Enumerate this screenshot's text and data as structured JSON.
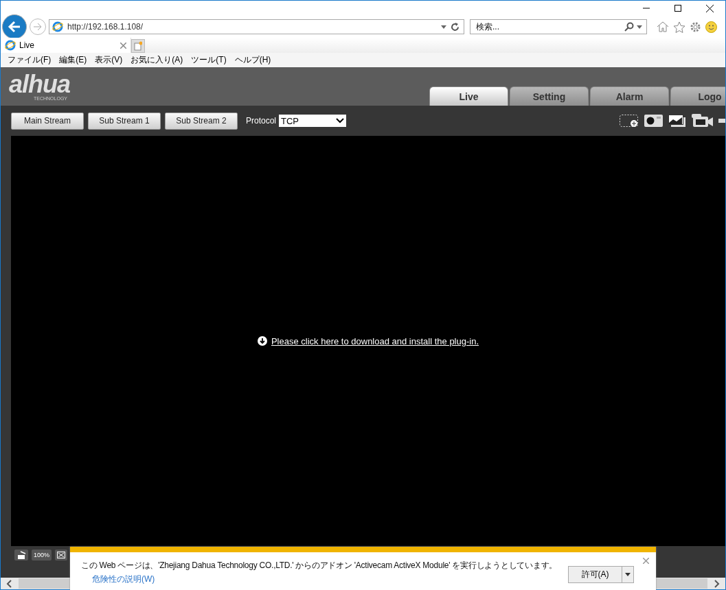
{
  "browser": {
    "address": "http://192.168.1.108/",
    "search": {
      "placeholder": "検索..."
    },
    "tabs": [
      {
        "title": "Live",
        "selected": true
      }
    ],
    "menu": [
      "ファイル(F)",
      "編集(E)",
      "表示(V)",
      "お気に入り(A)",
      "ツール(T)",
      "ヘルプ(H)"
    ]
  },
  "header": {
    "logo": "alhua",
    "logo_sub": "TECHNOLOGY",
    "nav_tabs": [
      {
        "label": "Live",
        "selected": true
      },
      {
        "label": "Setting",
        "selected": false
      },
      {
        "label": "Alarm",
        "selected": false
      },
      {
        "label": "Logo",
        "selected": false
      }
    ]
  },
  "toolbar": {
    "streams": [
      {
        "label": "Main Stream"
      },
      {
        "label": "Sub Stream 1"
      },
      {
        "label": "Sub Stream 2"
      }
    ],
    "protocol_label": "Protocol",
    "protocol_value": "TCP"
  },
  "video": {
    "plugin_link": "Please click here to download and install the plug-in."
  },
  "bottom_bar": {
    "zoom_label": "100%"
  },
  "notification": {
    "message": "この Web ページは、'Zhejiang Dahua Technology  CO.,LTD.' からのアドオン 'Activecam ActiveX Module' を実行しようとしています。",
    "link": "危険性の説明(W)",
    "allow_button": "許可(A)"
  }
}
